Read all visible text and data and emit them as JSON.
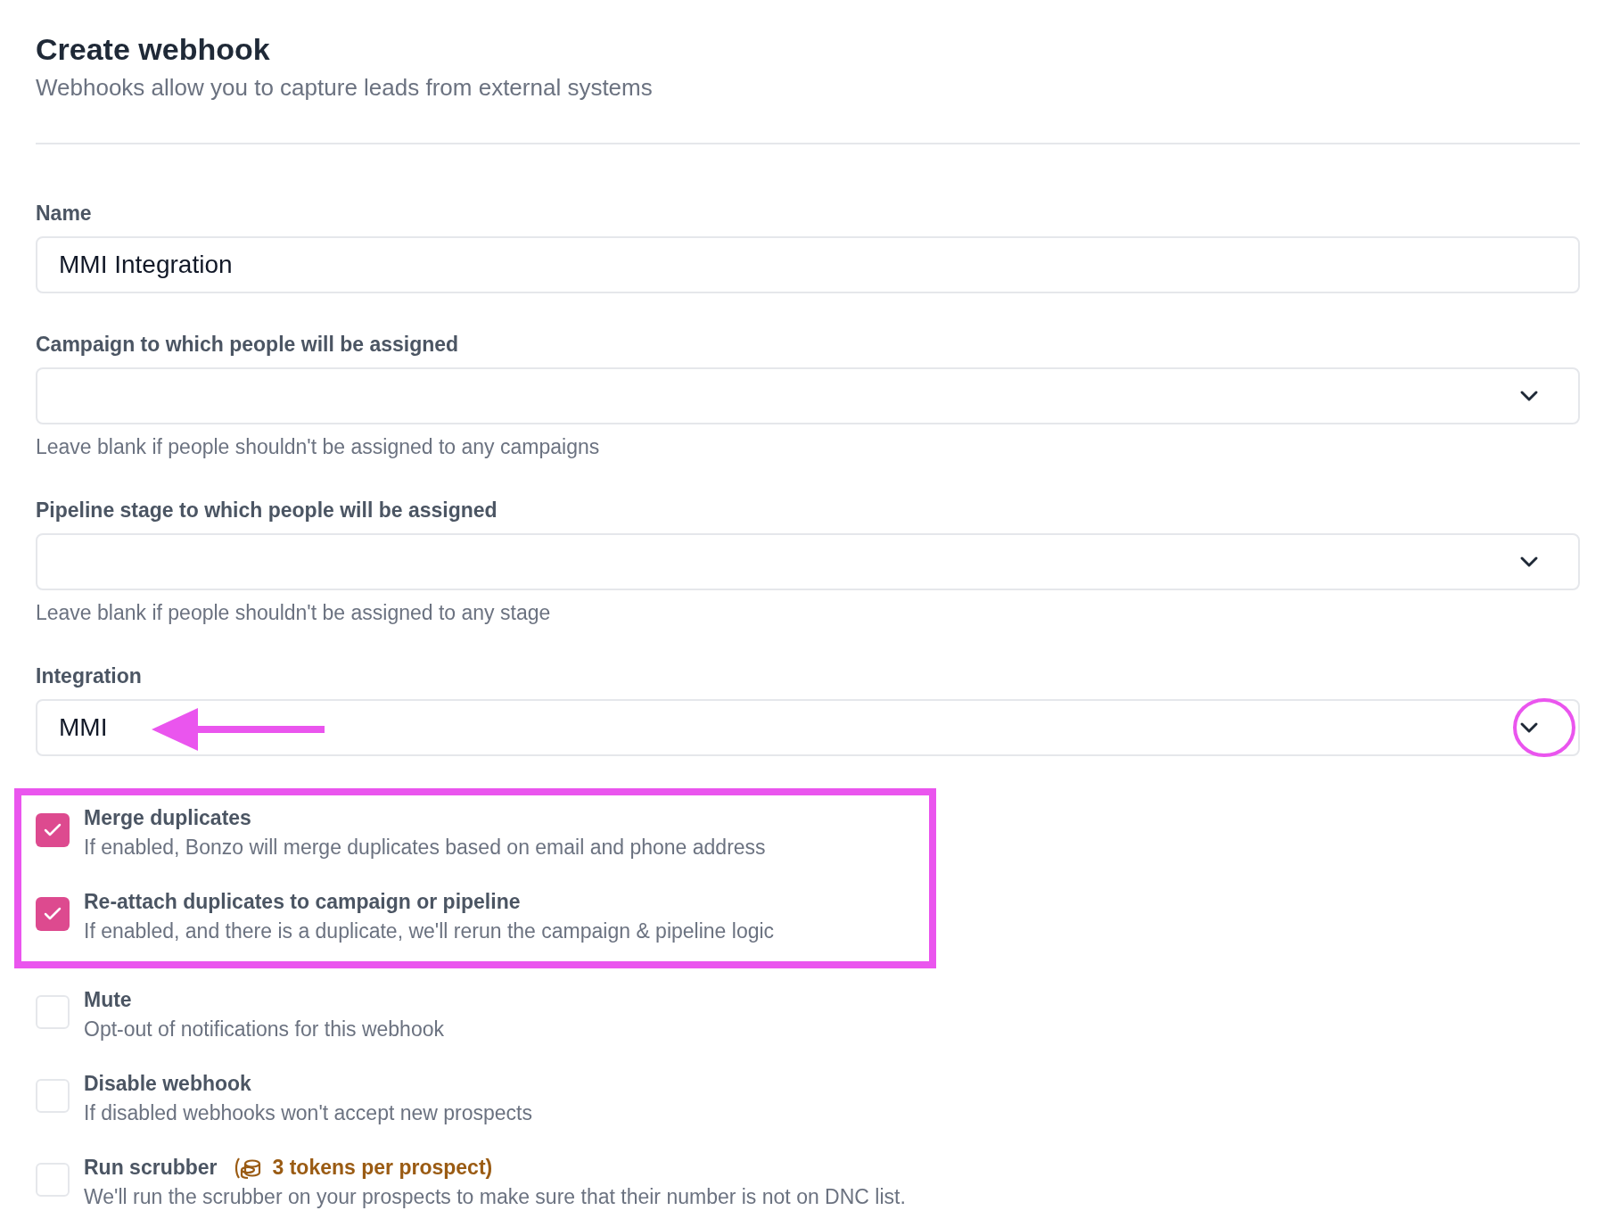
{
  "header": {
    "title": "Create webhook",
    "subtitle": "Webhooks allow you to capture leads from external systems"
  },
  "fields": [
    {
      "kind": "text",
      "label": "Name",
      "value": "MMI Integration"
    },
    {
      "kind": "select",
      "label": "Campaign to which people will be assigned",
      "help": "Leave blank if people shouldn't be assigned to any campaigns"
    },
    {
      "kind": "select",
      "label": "Pipeline stage to which people will be assigned",
      "help": "Leave blank if people shouldn't be assigned to any stage"
    },
    {
      "kind": "select",
      "label": "Integration",
      "value": "MMI",
      "pointer_arrow": true,
      "chevron_circled": true
    }
  ],
  "options": [
    {
      "title": "Merge duplicates",
      "description": "If enabled, Bonzo will merge duplicates based on email and phone address",
      "checked": true,
      "highlighted": true
    },
    {
      "title": "Re-attach duplicates to campaign or pipeline",
      "description": "If enabled, and there is a duplicate, we'll rerun the campaign & pipeline logic",
      "checked": true,
      "highlighted": true
    },
    {
      "title": "Mute",
      "description": "Opt-out of notifications for this webhook",
      "checked": false,
      "highlighted": false
    },
    {
      "title": "Disable webhook",
      "description": "If disabled webhooks won't accept new prospects",
      "checked": false,
      "highlighted": false
    },
    {
      "title": "Run scrubber",
      "cost": "3 tokens per prospect)",
      "description": "We'll run the scrubber on your prospects to make sure that their number is not on DNC list.",
      "checked": false,
      "highlighted": false
    }
  ]
}
